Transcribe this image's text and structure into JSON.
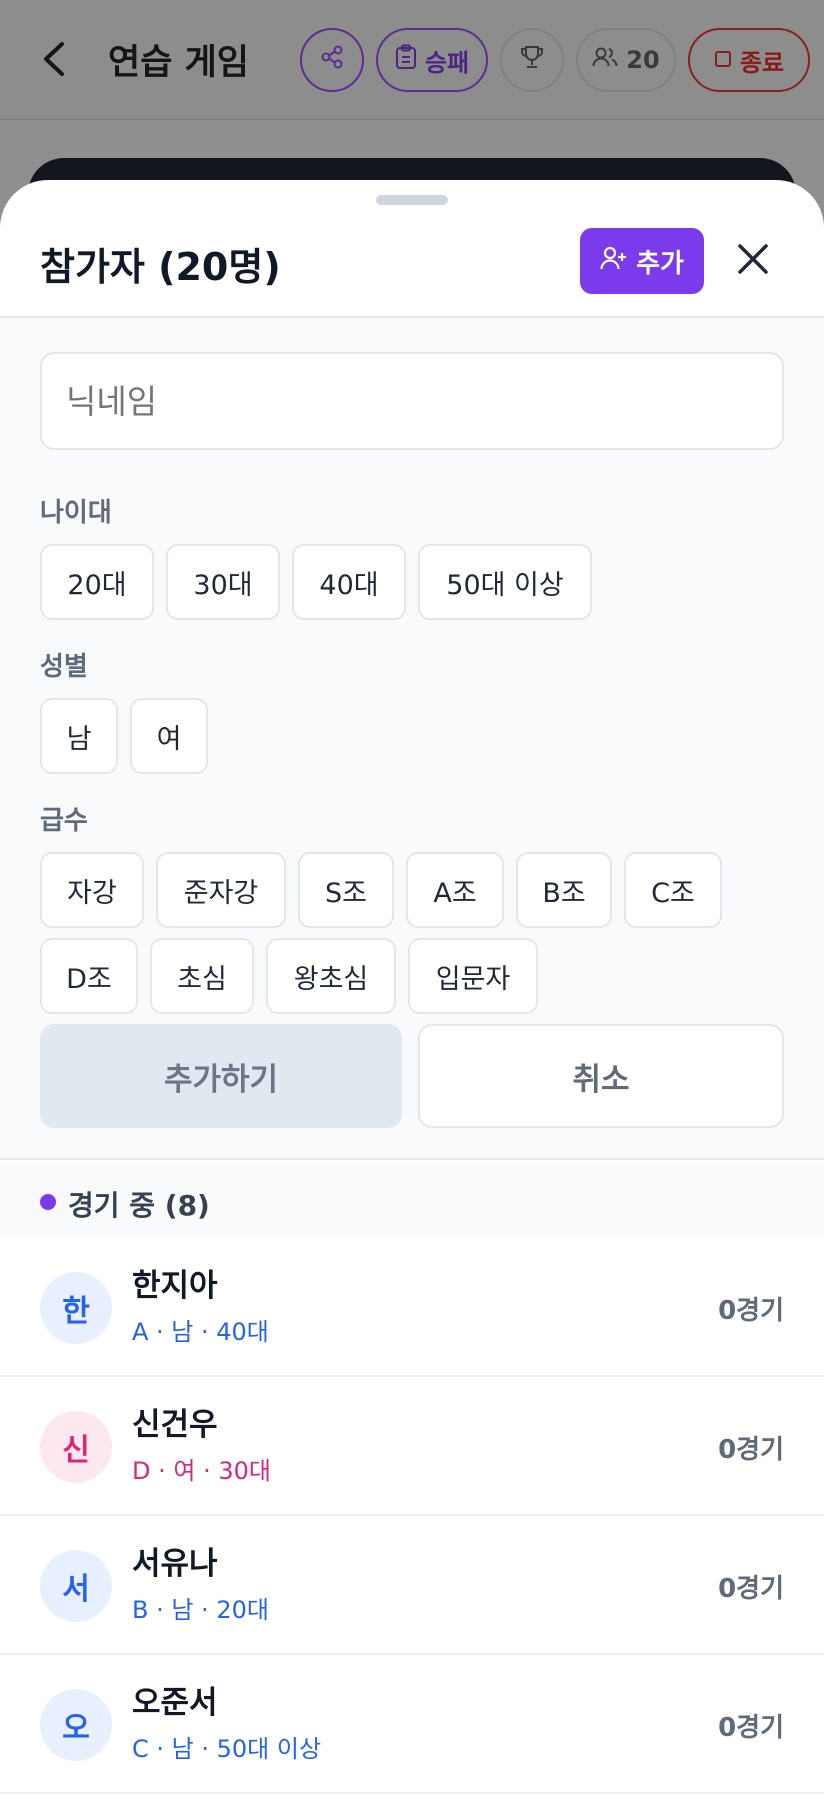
{
  "header": {
    "title": "연습 게임",
    "record_label": "승패",
    "people_count": "20",
    "end_label": "종료"
  },
  "sheet": {
    "title": "참가자 (20명)",
    "add_label": "추가"
  },
  "form": {
    "nickname_placeholder": "닉네임",
    "age_label": "나이대",
    "ages": [
      "20대",
      "30대",
      "40대",
      "50대 이상"
    ],
    "gender_label": "성별",
    "genders": [
      "남",
      "여"
    ],
    "grade_label": "급수",
    "grades": [
      "자강",
      "준자강",
      "S조",
      "A조",
      "B조",
      "C조",
      "D조",
      "초심",
      "왕초심",
      "입문자"
    ],
    "submit_label": "추가하기",
    "cancel_label": "취소"
  },
  "playing": {
    "title": "경기 중 (8)",
    "players": [
      {
        "initial": "한",
        "name": "한지아",
        "meta": "A · 남 · 40대",
        "games": "0경기",
        "color": "#2563eb"
      },
      {
        "initial": "신",
        "name": "신건우",
        "meta": "D · 여 · 30대",
        "games": "0경기",
        "color": "#db2777"
      },
      {
        "initial": "서",
        "name": "서유나",
        "meta": "B · 남 · 20대",
        "games": "0경기",
        "color": "#2563eb"
      },
      {
        "initial": "오",
        "name": "오준서",
        "meta": "C · 남 · 50대 이상",
        "games": "0경기",
        "color": "#2563eb"
      }
    ]
  },
  "colors": {
    "accent": "#7c3aed",
    "male": "#2563eb",
    "female": "#db2777"
  }
}
